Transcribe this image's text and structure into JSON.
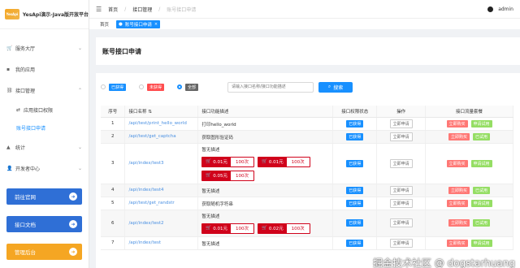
{
  "app": {
    "logo_text": "YesApi",
    "title": "YesApi演示-Java版开放平台"
  },
  "header": {
    "breadcrumbs": [
      "首页",
      "接口管理",
      "账号接口申请"
    ],
    "user": "admin"
  },
  "tabs": [
    {
      "label": "首页"
    },
    {
      "label": "账号接口申请",
      "close": "×"
    }
  ],
  "sidebar": {
    "items": [
      {
        "label": "服务大厅"
      },
      {
        "label": "我的应用"
      },
      {
        "label": "接口管理"
      },
      {
        "label": "应用接口权限"
      },
      {
        "label": "账号接口申请"
      },
      {
        "label": "统计"
      },
      {
        "label": "开发者中心"
      }
    ],
    "buttons": [
      {
        "label": "前往官网",
        "color": "#2f6fd6"
      },
      {
        "label": "接口文档",
        "color": "#2f6fd6"
      },
      {
        "label": "管理后台",
        "color": "#f5a623"
      }
    ]
  },
  "page": {
    "title": "账号接口申请"
  },
  "filter": {
    "options": [
      {
        "label": "已获得",
        "color": "#1890ff"
      },
      {
        "label": "未获得",
        "color": "#ff4d4f"
      },
      {
        "label": "全部",
        "color": "#666666"
      }
    ],
    "search_placeholder": "请输入接口名称/接口功能描述",
    "search_button": "搜索"
  },
  "table": {
    "headers": [
      "序号",
      "接口名称 ⇅",
      "接口功能描述",
      "接口权限状态",
      "操作",
      "接口流量套餐"
    ],
    "status_label": "已获得",
    "op_label": "立即申请",
    "pay_label": "立即购买",
    "apply_pay_label": "申请试用",
    "got_label": "已试用",
    "rows": [
      {
        "no": "1",
        "name": "/api/test/print_hello_world",
        "desc": "打印hello_world",
        "prices": []
      },
      {
        "no": "2",
        "name": "/api/test/get_captcha",
        "desc": "获取图形验证码",
        "prices": []
      },
      {
        "no": "3",
        "name": "/api/index/test3",
        "desc": "暂无描述",
        "prices": [
          {
            "price": "0.01元",
            "count": "100次"
          },
          {
            "price": "0.01元",
            "count": "100次"
          },
          {
            "price": "0.05元",
            "count": "100次"
          }
        ]
      },
      {
        "no": "4",
        "name": "/api/index/test4",
        "desc": "暂无描述",
        "prices": []
      },
      {
        "no": "5",
        "name": "/api/test/get_randstr",
        "desc": "获取随机字符串",
        "prices": []
      },
      {
        "no": "6",
        "name": "/api/index/test2",
        "desc": "暂无描述",
        "prices": [
          {
            "price": "0.01元",
            "count": "100次"
          },
          {
            "price": "0.02元",
            "count": "100次"
          }
        ]
      },
      {
        "no": "7",
        "name": "/api/index/test",
        "desc": "暂无描述",
        "prices": []
      }
    ]
  },
  "watermark": "掘金技术社区 @ dogstarhuang"
}
